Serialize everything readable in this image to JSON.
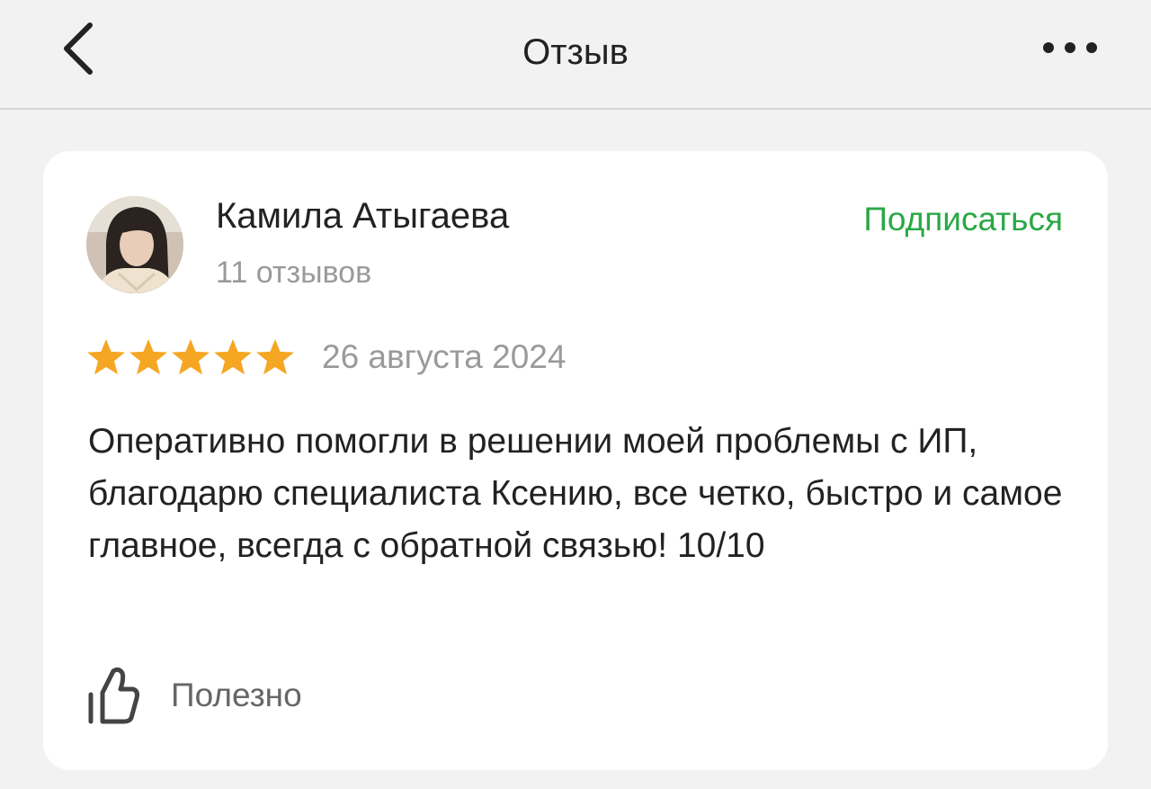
{
  "header": {
    "title": "Отзыв",
    "back_icon": "chevron-left-icon",
    "more_icon": "more-horizontal-icon"
  },
  "review": {
    "author": {
      "name": "Камила Атыгаева",
      "reviews_count": "11 отзывов",
      "avatar": "user-photo"
    },
    "subscribe_label": "Подписаться",
    "rating": 5,
    "rating_max": 5,
    "date": "26 августа 2024",
    "text": "Оперативно помогли в решении моей проблемы с ИП, благодарю специалиста Ксению, все четко, быстро и самое главное, всегда с обратной связью! 10/10",
    "useful_label": "Полезно",
    "useful_icon": "thumbs-up-icon"
  },
  "colors": {
    "accent_green": "#2aa845",
    "star": "#f5a623",
    "background": "#f2f2f2",
    "card": "#ffffff"
  }
}
